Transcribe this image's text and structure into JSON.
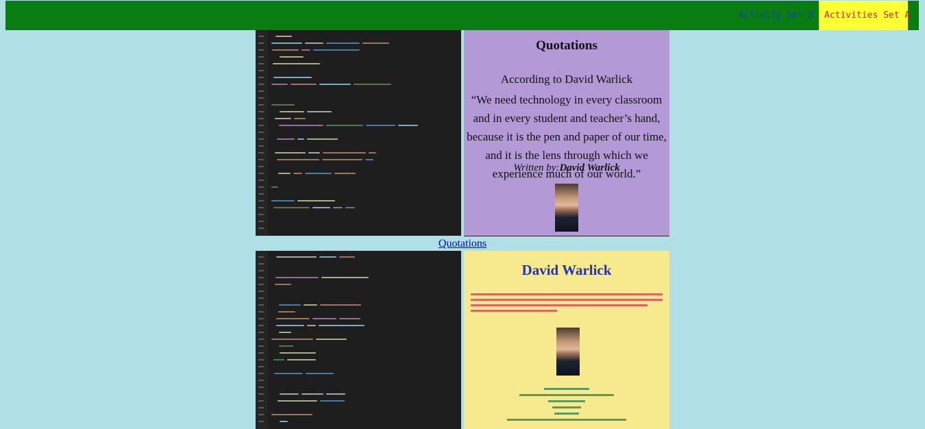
{
  "nav": {
    "activity_set_b": "Activity Set B",
    "activities_set_a": "Activities Set A"
  },
  "quote_card": {
    "title": "Quotations",
    "according_to": "According to David Warlick",
    "quote": "“We need technology in every classroom and in every student and teacher’s hand, because it is the pen and paper of our time, and it is the lens through which we experience much of our world.”",
    "written_by": "Written by:",
    "author": "David Warlick"
  },
  "caption": {
    "link_text": "Quotations"
  },
  "bio_card": {
    "title": "David Warlick"
  },
  "colors": {
    "page_background": "#b0e0e6",
    "nav_background": "#0a7d12",
    "nav_active_background": "#ffff33",
    "quote_background": "#b39ad6",
    "bio_background": "#f7e98e"
  }
}
